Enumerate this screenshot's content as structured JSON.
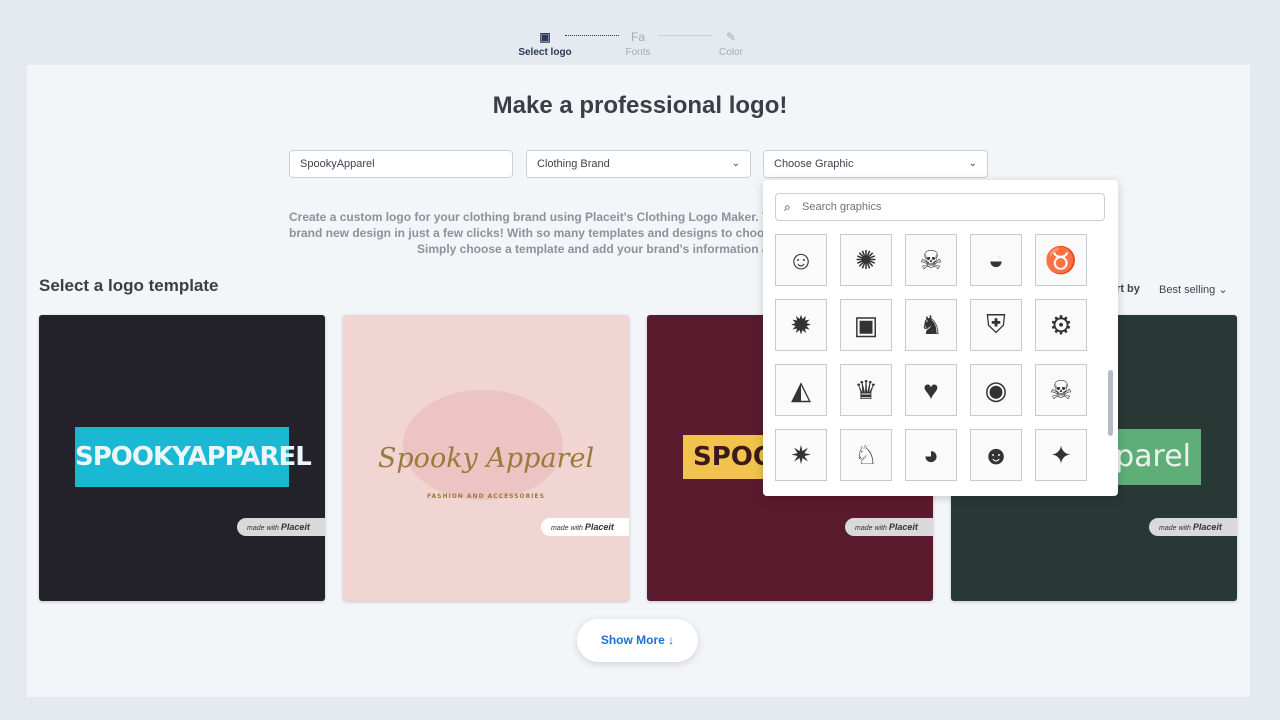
{
  "stepper": {
    "steps": [
      {
        "label": "Select logo",
        "icon": "image-icon",
        "active": true
      },
      {
        "label": "Fonts",
        "icon": "font-icon",
        "active": false
      },
      {
        "label": "Color",
        "icon": "brush-icon",
        "active": false
      }
    ]
  },
  "title": "Make a professional logo!",
  "form": {
    "brand_name": "SpookyApparel",
    "category": "Clothing Brand",
    "graphic_placeholder": "Choose Graphic"
  },
  "description": [
    "Create a custom logo for your clothing brand using Placeit's Clothing Logo Maker. You can",
    "brand new design in just a few clicks! With so many templates and designs to choose from",
    "Simply choose a template and add your brand's information and"
  ],
  "section_title": "Select a logo template",
  "sort": {
    "label": "Sort by",
    "value": "Best selling"
  },
  "graphic_dropdown": {
    "search_placeholder": "Search graphics",
    "graphics": [
      "dog-headphones",
      "scorpion",
      "skulls-chain",
      "sleeping-dog",
      "bull",
      "alien-skull",
      "robot-box",
      "unicorn",
      "lion-shield",
      "motorcycle",
      "shark",
      "crown",
      "anatomical-heart",
      "wave-circle",
      "sugar-skull",
      "gorilla-sun",
      "rabbit",
      "teddy-bear",
      "hooded-skull",
      "moth"
    ]
  },
  "templates": [
    {
      "text": "SPOOKYAPPAREL",
      "bg": "#232129",
      "banner": "#1bb8d4"
    },
    {
      "text": "Spooky Apparel",
      "subtitle": "FASHION AND ACCESSORIES",
      "bg": "#f0d5d3",
      "color": "#9b7a3a"
    },
    {
      "text": "SPOOK",
      "bg": "#5a1a2d",
      "banner": "#f1c24e"
    },
    {
      "text": "pparel",
      "bg": "#283834",
      "banner": "#5fae78"
    }
  ],
  "watermark": {
    "prefix": "made with",
    "brand": "Placeit"
  },
  "show_more": "Show More"
}
